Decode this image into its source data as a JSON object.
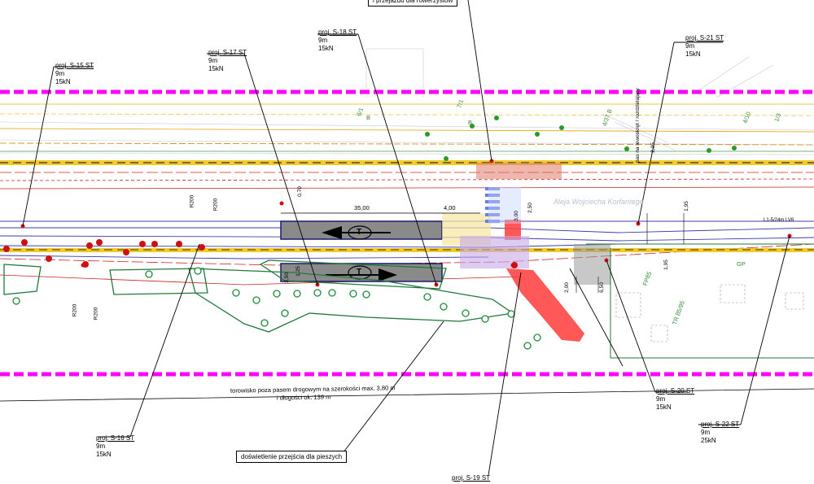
{
  "callouts": [
    {
      "id": "s15",
      "title": "proj. S-15 ST",
      "height": "9m",
      "load": "15kN"
    },
    {
      "id": "s16",
      "title": "proj. S-16 ST",
      "height": "9m",
      "load": "15kN"
    },
    {
      "id": "s17",
      "title": "proj. S-17 ST",
      "height": "9m",
      "load": "15kN"
    },
    {
      "id": "s18",
      "title": "proj. S-18 ST",
      "height": "9m",
      "load": "15kN"
    },
    {
      "id": "s19",
      "title": "proj. S-19 ST"
    },
    {
      "id": "s20",
      "title": "proj. S-20 ST",
      "height": "9m",
      "load": "15kN"
    },
    {
      "id": "s21",
      "title": "proj. S-21 ST",
      "height": "9m",
      "load": "15kN"
    },
    {
      "id": "s22",
      "title": "proj. S-22 ST",
      "height": "9m",
      "load": "25kN"
    }
  ],
  "boxes": {
    "crossing_top": "i przejazdu dla rowerzystów",
    "crossing_ped": "doświetlenie przejścia dla pieszych"
  },
  "notes": {
    "torowisko_1": "torowisko poza pasem drogowym na szerokości max. 3,80 m",
    "torowisko_2": "i długości ok. 139 m",
    "street": "Aleja Wojciecha Korfantego",
    "lane_note": "pas na lewoskręt / rozdzielający",
    "cable": "L1-5/24m LV6"
  },
  "dims": {
    "d35": "35,00",
    "d4": "4,00",
    "d070": "0,70",
    "d350": "3,50",
    "d125": "1,25",
    "d300": "3,00",
    "d250": "2,50",
    "d195": "1,95",
    "d195b": "1,95",
    "d205": "2,05",
    "d200": "2,00",
    "d650": "6,50",
    "r1": "R200",
    "r2": "R200",
    "r3": "R200",
    "r4": "R200"
  },
  "tram_symbol": "T",
  "grid_refs": [
    "6/1",
    "B",
    "7/1",
    "B",
    "4/37 B",
    "4/10",
    "1/3",
    "FP85",
    "TR 85/95",
    "GP"
  ],
  "colors": {
    "boundary": "#ff00ff",
    "tram": "#7b7bd6",
    "road": "#f2c200",
    "pavement": "#ff9a9a",
    "highlight": "#ff3b3b"
  }
}
